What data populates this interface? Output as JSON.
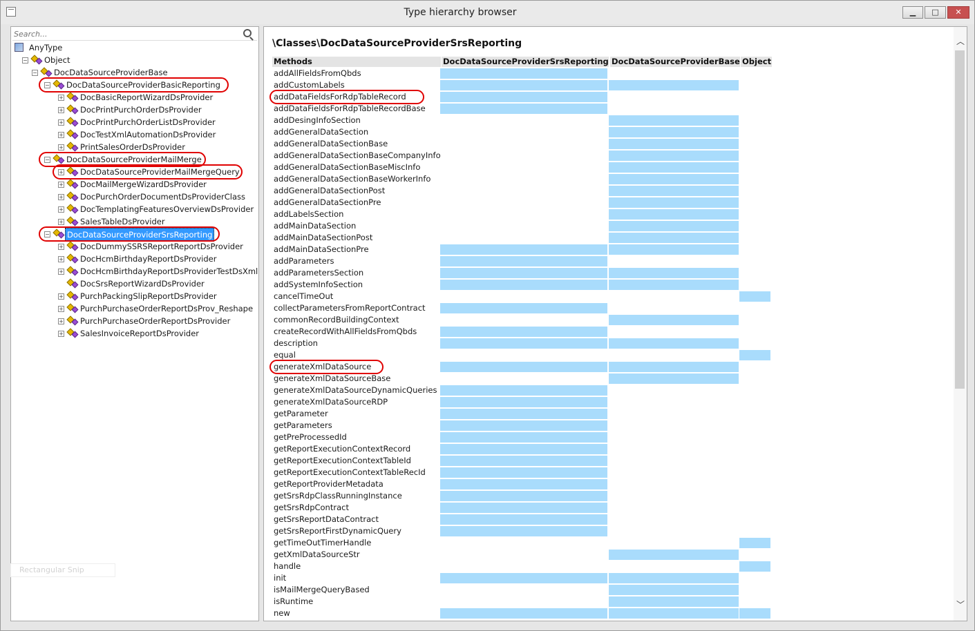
{
  "window": {
    "title": "Type hierarchy browser",
    "min": "▁",
    "max": "□",
    "close": "✕"
  },
  "search": {
    "placeholder": "Search..."
  },
  "tree": {
    "root": "AnyType",
    "object": "Object",
    "base": "DocDataSourceProviderBase",
    "basic": "DocDataSourceProviderBasicReporting",
    "basic_children": [
      "DocBasicReportWizardDsProvider",
      "DocPrintPurchOrderDsProvider",
      "DocPrintPurchOrderListDsProvider",
      "DocTestXmlAutomationDsProvider",
      "PrintSalesOrderDsProvider"
    ],
    "mail": "DocDataSourceProviderMailMerge",
    "mail_children": [
      "DocDataSourceProviderMailMergeQuery",
      "DocMailMergeWizardDsProvider",
      "DocPurchOrderDocumentDsProviderClass",
      "DocTemplatingFeaturesOverviewDsProvider",
      "SalesTableDsProvider"
    ],
    "srs": "DocDataSourceProviderSrsReporting",
    "srs_children": [
      "DocDummySSRSReportReportDsProvider",
      "DocHcmBirthdayReportDsProvider",
      "DocHcmBirthdayReportDsProviderTestDsXml",
      "DocSrsReportWizardDsProvider",
      "PurchPackingSlipReportDsProvider",
      "PurchPurchaseOrderReportDsProv_Reshape",
      "PurchPurchaseOrderReportDsProvider",
      "SalesInvoiceReportDsProvider"
    ]
  },
  "snip": "Rectangular Snip",
  "content": {
    "path": "\\Classes\\DocDataSourceProviderSrsReporting",
    "columns": [
      "Methods",
      "DocDataSourceProviderSrsReporting",
      "DocDataSourceProviderBase",
      "Object"
    ],
    "methods": [
      {
        "name": "addAllFieldsFromQbds",
        "srs": true,
        "base": false,
        "obj": false
      },
      {
        "name": "addCustomLabels",
        "srs": true,
        "base": true,
        "obj": false
      },
      {
        "name": "addDataFieldsForRdpTableRecord",
        "srs": true,
        "base": false,
        "obj": false
      },
      {
        "name": "addDataFieldsForRdpTableRecordBase",
        "srs": true,
        "base": false,
        "obj": false
      },
      {
        "name": "addDesingInfoSection",
        "srs": false,
        "base": true,
        "obj": false
      },
      {
        "name": "addGeneralDataSection",
        "srs": false,
        "base": true,
        "obj": false
      },
      {
        "name": "addGeneralDataSectionBase",
        "srs": false,
        "base": true,
        "obj": false
      },
      {
        "name": "addGeneralDataSectionBaseCompanyInfo",
        "srs": false,
        "base": true,
        "obj": false
      },
      {
        "name": "addGeneralDataSectionBaseMiscInfo",
        "srs": false,
        "base": true,
        "obj": false
      },
      {
        "name": "addGeneralDataSectionBaseWorkerInfo",
        "srs": false,
        "base": true,
        "obj": false
      },
      {
        "name": "addGeneralDataSectionPost",
        "srs": false,
        "base": true,
        "obj": false
      },
      {
        "name": "addGeneralDataSectionPre",
        "srs": false,
        "base": true,
        "obj": false
      },
      {
        "name": "addLabelsSection",
        "srs": false,
        "base": true,
        "obj": false
      },
      {
        "name": "addMainDataSection",
        "srs": false,
        "base": true,
        "obj": false
      },
      {
        "name": "addMainDataSectionPost",
        "srs": false,
        "base": true,
        "obj": false
      },
      {
        "name": "addMainDataSectionPre",
        "srs": true,
        "base": true,
        "obj": false
      },
      {
        "name": "addParameters",
        "srs": true,
        "base": false,
        "obj": false
      },
      {
        "name": "addParametersSection",
        "srs": true,
        "base": true,
        "obj": false
      },
      {
        "name": "addSystemInfoSection",
        "srs": true,
        "base": true,
        "obj": false
      },
      {
        "name": "cancelTimeOut",
        "srs": false,
        "base": false,
        "obj": true
      },
      {
        "name": "collectParametersFromReportContract",
        "srs": true,
        "base": false,
        "obj": false
      },
      {
        "name": "commonRecordBuildingContext",
        "srs": false,
        "base": true,
        "obj": false
      },
      {
        "name": "createRecordWithAllFieldsFromQbds",
        "srs": true,
        "base": false,
        "obj": false
      },
      {
        "name": "description",
        "srs": true,
        "base": true,
        "obj": false
      },
      {
        "name": "equal",
        "srs": false,
        "base": false,
        "obj": true
      },
      {
        "name": "generateXmlDataSource",
        "srs": true,
        "base": true,
        "obj": false
      },
      {
        "name": "generateXmlDataSourceBase",
        "srs": false,
        "base": true,
        "obj": false
      },
      {
        "name": "generateXmlDataSourceDynamicQueries",
        "srs": true,
        "base": false,
        "obj": false
      },
      {
        "name": "generateXmlDataSourceRDP",
        "srs": true,
        "base": false,
        "obj": false
      },
      {
        "name": "getParameter",
        "srs": true,
        "base": false,
        "obj": false
      },
      {
        "name": "getParameters",
        "srs": true,
        "base": false,
        "obj": false
      },
      {
        "name": "getPreProcessedId",
        "srs": true,
        "base": false,
        "obj": false
      },
      {
        "name": "getReportExecutionContextRecord",
        "srs": true,
        "base": false,
        "obj": false
      },
      {
        "name": "getReportExecutionContextTableId",
        "srs": true,
        "base": false,
        "obj": false
      },
      {
        "name": "getReportExecutionContextTableRecId",
        "srs": true,
        "base": false,
        "obj": false
      },
      {
        "name": "getReportProviderMetadata",
        "srs": true,
        "base": false,
        "obj": false
      },
      {
        "name": "getSrsRdpClassRunningInstance",
        "srs": true,
        "base": false,
        "obj": false
      },
      {
        "name": "getSrsRdpContract",
        "srs": true,
        "base": false,
        "obj": false
      },
      {
        "name": "getSrsReportDataContract",
        "srs": true,
        "base": false,
        "obj": false
      },
      {
        "name": "getSrsReportFirstDynamicQuery",
        "srs": true,
        "base": false,
        "obj": false
      },
      {
        "name": "getTimeOutTimerHandle",
        "srs": false,
        "base": false,
        "obj": true
      },
      {
        "name": "getXmlDataSourceStr",
        "srs": false,
        "base": true,
        "obj": false
      },
      {
        "name": "handle",
        "srs": false,
        "base": false,
        "obj": true
      },
      {
        "name": "init",
        "srs": true,
        "base": true,
        "obj": false
      },
      {
        "name": "isMailMergeQueryBased",
        "srs": false,
        "base": true,
        "obj": false
      },
      {
        "name": "isRuntime",
        "srs": false,
        "base": true,
        "obj": false
      },
      {
        "name": "new",
        "srs": true,
        "base": true,
        "obj": true
      }
    ]
  },
  "scrollbar": {
    "up": "︿",
    "down": "﹀"
  },
  "colors": {
    "accent": "#3399ff",
    "cell": "#a9dcfc",
    "ring": "#e00000"
  }
}
